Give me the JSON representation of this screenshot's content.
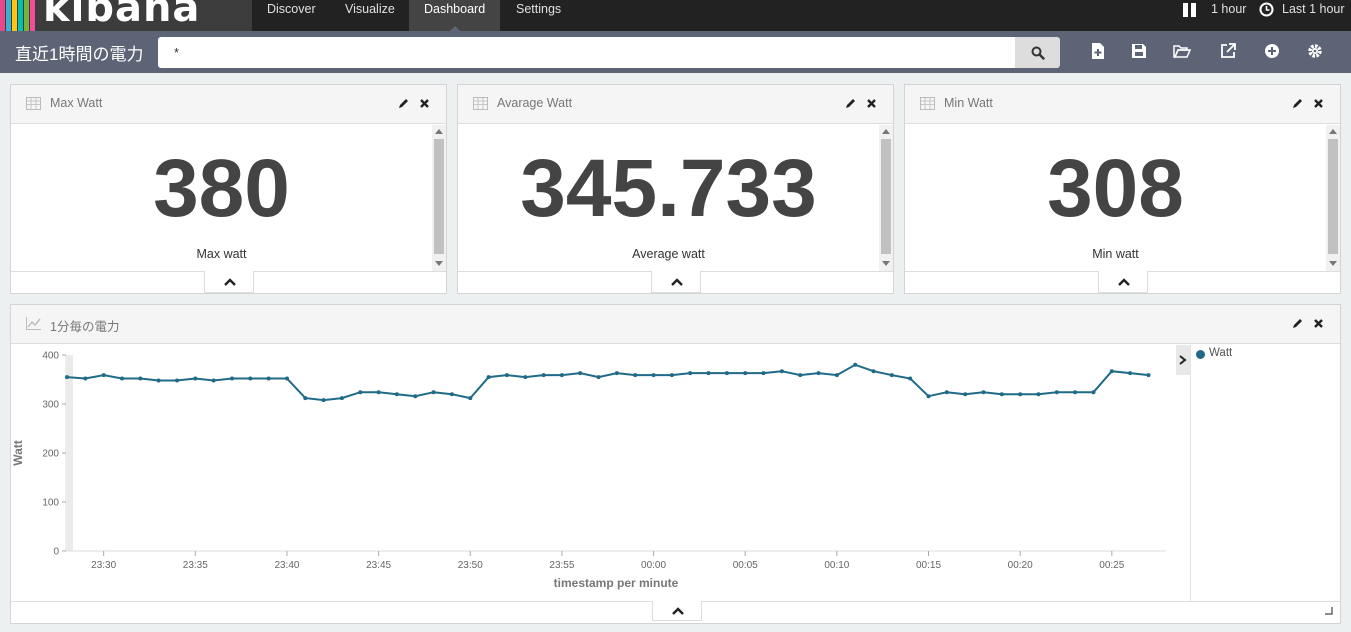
{
  "app": {
    "logo_text": "kibana",
    "logo_colors": [
      "#e8488b",
      "#3caed2",
      "#fec514",
      "#00bfb3",
      "#79b33e",
      "#f04e98"
    ]
  },
  "nav": {
    "items": [
      {
        "label": "Discover",
        "active": false
      },
      {
        "label": "Visualize",
        "active": false
      },
      {
        "label": "Dashboard",
        "active": true
      },
      {
        "label": "Settings",
        "active": false
      }
    ],
    "refresh_interval": "1 hour",
    "time_range": "Last 1 hour"
  },
  "query": {
    "dashboard_title": "直近1時間の電力",
    "value": "*"
  },
  "toolbar": {
    "icons": [
      "new-dashboard-icon",
      "save-icon",
      "open-folder-icon",
      "share-icon",
      "add-visualization-icon",
      "settings-gear-icon"
    ]
  },
  "panels": [
    {
      "title": "Max Watt",
      "value": "380",
      "label": "Max watt"
    },
    {
      "title": "Avarage Watt",
      "value": "345.733",
      "label": "Average watt"
    },
    {
      "title": "Min Watt",
      "value": "308",
      "label": "Min watt"
    }
  ],
  "chart_panel": {
    "title": "1分毎の電力"
  },
  "chart_data": {
    "type": "line",
    "xlabel": "timestamp per minute",
    "ylabel": "Watt",
    "ylim": [
      0,
      400
    ],
    "yticks": [
      0,
      100,
      200,
      300,
      400
    ],
    "xticks": [
      "23:30",
      "23:35",
      "23:40",
      "23:45",
      "23:50",
      "23:55",
      "00:00",
      "00:05",
      "00:10",
      "00:15",
      "00:20",
      "00:25"
    ],
    "x_start": "23:28",
    "x_interval_minutes": 1,
    "series": [
      {
        "name": "Watt",
        "color": "#1f6b87",
        "values": [
          355,
          352,
          359,
          352,
          352,
          348,
          348,
          352,
          348,
          352,
          352,
          352,
          352,
          312,
          308,
          312,
          324,
          324,
          320,
          316,
          324,
          320,
          312,
          355,
          359,
          355,
          359,
          359,
          363,
          355,
          363,
          359,
          359,
          359,
          363,
          363,
          363,
          363,
          363,
          367,
          359,
          363,
          359,
          380,
          367,
          359,
          352,
          316,
          324,
          320,
          324,
          320,
          320,
          320,
          324,
          324,
          324,
          367,
          363,
          359
        ]
      }
    ],
    "legend": "right",
    "grid": false
  }
}
